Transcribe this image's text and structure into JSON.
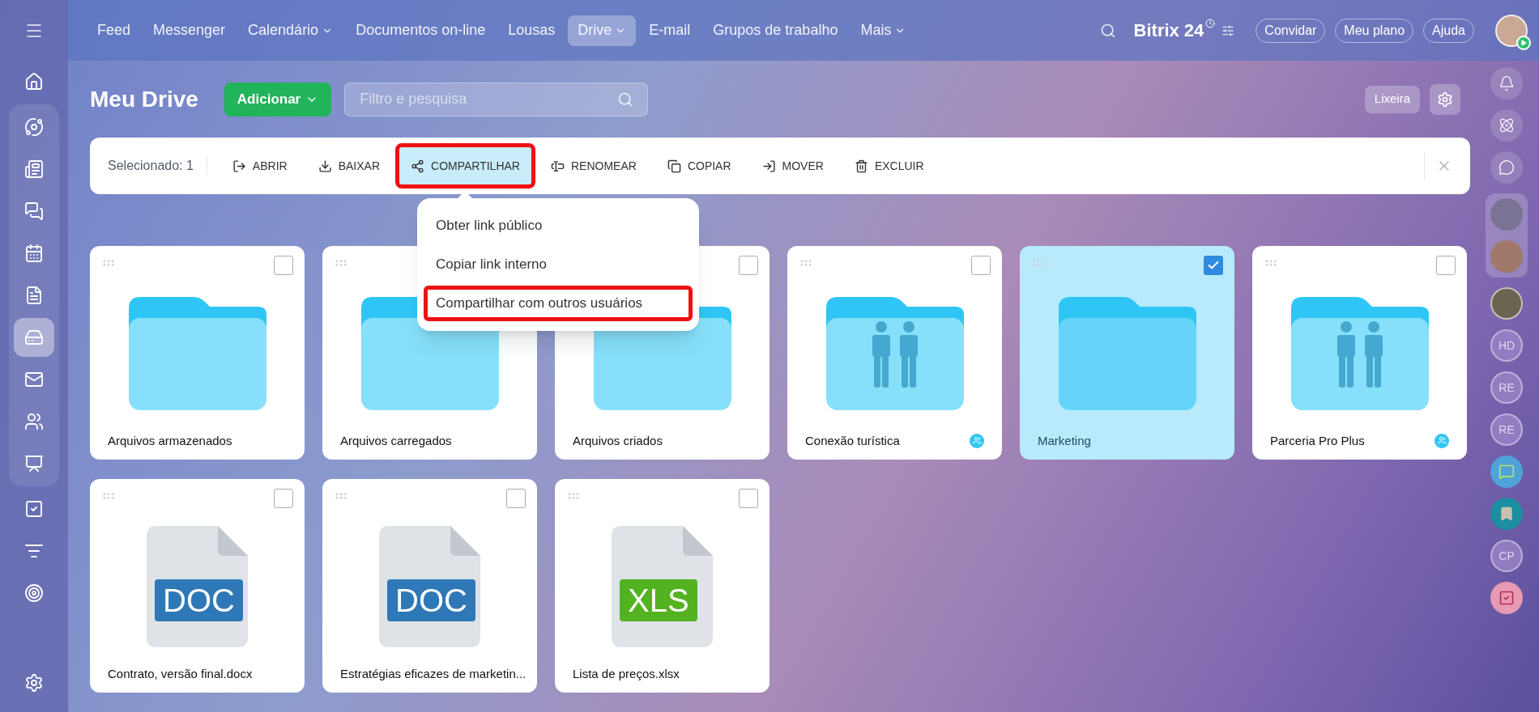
{
  "top_nav": {
    "items": [
      {
        "label": "Feed",
        "dropdown": false,
        "selected": false
      },
      {
        "label": "Messenger",
        "dropdown": false,
        "selected": false
      },
      {
        "label": "Calendário",
        "dropdown": true,
        "selected": false
      },
      {
        "label": "Documentos on-line",
        "dropdown": false,
        "selected": false
      },
      {
        "label": "Lousas",
        "dropdown": false,
        "selected": false
      },
      {
        "label": "Drive",
        "dropdown": true,
        "selected": true
      },
      {
        "label": "E-mail",
        "dropdown": false,
        "selected": false
      },
      {
        "label": "Grupos de trabalho",
        "dropdown": false,
        "selected": false
      },
      {
        "label": "Mais",
        "dropdown": true,
        "selected": false
      }
    ],
    "logo": "Bitrix",
    "logo_number": "24",
    "buttons": [
      "Convidar",
      "Meu plano",
      "Ajuda"
    ]
  },
  "left_sidebar": {
    "groups": [
      {
        "framed": false,
        "items": [
          {
            "kind": "home",
            "selected": false
          }
        ]
      },
      {
        "framed": true,
        "items": [
          {
            "kind": "orbit",
            "selected": false
          },
          {
            "kind": "news",
            "selected": false
          },
          {
            "kind": "chat",
            "selected": false
          },
          {
            "kind": "calendar",
            "selected": false
          },
          {
            "kind": "document",
            "selected": false
          },
          {
            "kind": "drive",
            "selected": true
          },
          {
            "kind": "mail",
            "selected": false
          },
          {
            "kind": "users",
            "selected": false
          },
          {
            "kind": "presentation",
            "selected": false
          }
        ]
      },
      {
        "framed": false,
        "items": [
          {
            "kind": "task",
            "selected": false
          },
          {
            "kind": "funnel",
            "selected": false
          },
          {
            "kind": "target",
            "selected": false
          }
        ]
      }
    ],
    "footer_item": {
      "kind": "settings",
      "selected": false
    }
  },
  "header": {
    "title": "Meu Drive",
    "add_button": "Adicionar",
    "search": {
      "placeholder": "Filtro e pesquisa"
    },
    "trash_button": "Lixeira"
  },
  "toolbar": {
    "selected_count": "Selecionado: 1",
    "actions": [
      {
        "label": "ABRIR",
        "kind": "open",
        "active": false,
        "highlighted": false
      },
      {
        "label": "BAIXAR",
        "kind": "download",
        "active": false,
        "highlighted": false
      },
      {
        "label": "COMPARTILHAR",
        "kind": "share",
        "active": true,
        "highlighted": true
      },
      {
        "label": "RENOMEAR",
        "kind": "rename",
        "active": false,
        "highlighted": false
      },
      {
        "label": "COPIAR",
        "kind": "copy",
        "active": false,
        "highlighted": false
      },
      {
        "label": "MOVER",
        "kind": "move",
        "active": false,
        "highlighted": false
      },
      {
        "label": "EXCLUIR",
        "kind": "delete",
        "active": false,
        "highlighted": false
      }
    ]
  },
  "share_menu": {
    "items": [
      {
        "label": "Obter link público",
        "highlighted": false
      },
      {
        "label": "Copiar link interno",
        "highlighted": false
      },
      {
        "label": "Compartilhar com outros usuários",
        "highlighted": true
      }
    ]
  },
  "items": [
    {
      "name": "Arquivos armazenados",
      "kind": "folder",
      "checked": false
    },
    {
      "name": "Arquivos carregados",
      "kind": "folder",
      "checked": false
    },
    {
      "name": "Arquivos criados",
      "kind": "folder",
      "checked": false
    },
    {
      "name": "Conexão turística",
      "kind": "shared_folder",
      "checked": false
    },
    {
      "name": "Marketing",
      "kind": "folder",
      "checked": true
    },
    {
      "name": "Parceria Pro Plus",
      "kind": "shared_folder",
      "checked": false
    },
    {
      "name": "Contrato, versão final.docx",
      "kind": "file",
      "type_label": "DOC",
      "color": "#2e78b7",
      "checked": false
    },
    {
      "name": "Estratégias eficazes de marketin...",
      "kind": "file",
      "type_label": "DOC",
      "color": "#2e78b7",
      "checked": false
    },
    {
      "name": "Lista de preços.xlsx",
      "kind": "file",
      "type_label": "XLS",
      "color": "#53b21f",
      "checked": false
    }
  ],
  "right_sidebar": {
    "items": [
      {
        "kind": "bell"
      },
      {
        "kind": "copilot"
      },
      {
        "kind": "chat_swap"
      },
      {
        "kind": "avatar_group"
      },
      {
        "kind": "avatar"
      },
      {
        "kind": "initials",
        "text": "HD"
      },
      {
        "kind": "initials",
        "text": "RE"
      },
      {
        "kind": "initials",
        "text": "RE"
      },
      {
        "kind": "chat_app"
      },
      {
        "kind": "bookmark"
      },
      {
        "kind": "initials",
        "text": "CP"
      },
      {
        "kind": "check_app"
      }
    ]
  }
}
